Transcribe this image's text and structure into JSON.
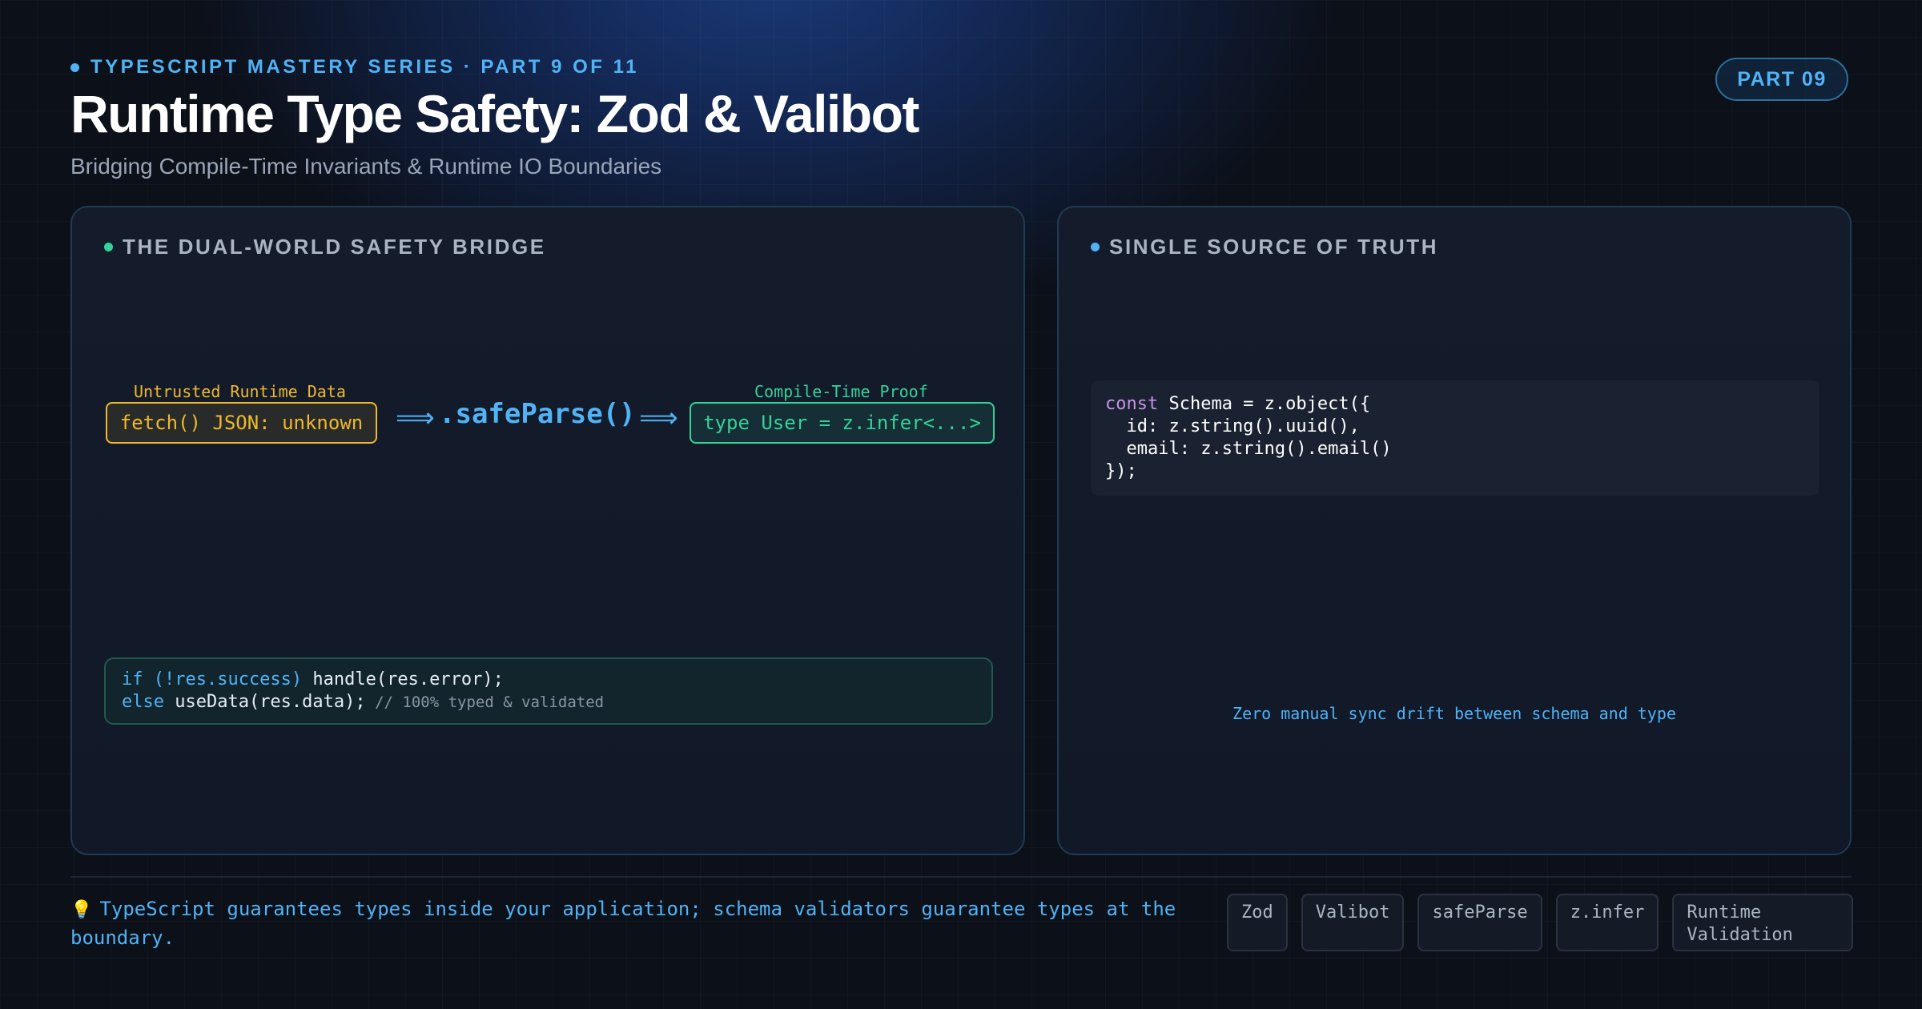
{
  "header": {
    "eyebrow": "TYPESCRIPT MASTERY SERIES · PART 9 OF 11",
    "title": "Runtime Type Safety: Zod & Valibot",
    "subtitle": "Bridging Compile-Time Invariants & Runtime IO Boundaries",
    "badge": "PART 09"
  },
  "left_panel": {
    "label": "THE DUAL-WORLD SAFETY BRIDGE",
    "untrusted_caption": "Untrusted Runtime Data",
    "untrusted_box": "fetch() JSON: unknown",
    "arrow": "⟹",
    "safe_parse": ".safeParse()",
    "compile_caption": "Compile-Time Proof",
    "compile_box": "type User = z.infer<...>",
    "code": {
      "line1_kw": "if (!res.success)",
      "line1_rest": " handle(res.error);",
      "line2_kw": "else",
      "line2_rest": " useData(res.data);",
      "line2_comment": " // 100% typed & validated"
    }
  },
  "right_panel": {
    "label": "SINGLE SOURCE OF TRUTH",
    "code": {
      "kw": "const",
      "line1_rest": " Schema = z.object({",
      "line2": "  id: z.string().uuid(),",
      "line3": "  email: z.string().email()",
      "line4": "});"
    },
    "caption": "Zero manual sync drift between schema and type"
  },
  "footer": {
    "icon": "lightbulb-icon",
    "note": "TypeScript guarantees types inside your application; schema validators guarantee types at the boundary.",
    "tags": [
      "Zod",
      "Valibot",
      "safeParse",
      "z.infer",
      "Runtime Validation"
    ]
  },
  "colors": {
    "accent_blue": "#4fb3f6",
    "accent_green": "#34d399",
    "accent_amber": "#f0b92b",
    "keyword_purple": "#c792ea",
    "background": "#0c1019"
  }
}
